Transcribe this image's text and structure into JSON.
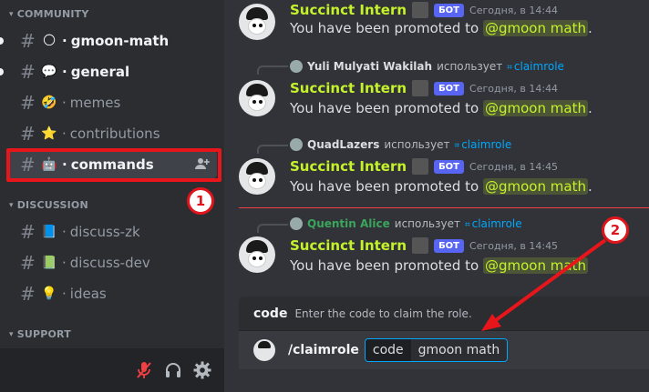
{
  "sidebar": {
    "categories": [
      {
        "label": "COMMUNITY"
      },
      {
        "label": "DISCUSSION"
      },
      {
        "label": "SUPPORT"
      }
    ],
    "channels": [
      {
        "name": "gmoon-math",
        "emoji": "🌕"
      },
      {
        "name": "general",
        "emoji": "💬"
      },
      {
        "name": "memes",
        "emoji": "🤣"
      },
      {
        "name": "contributions",
        "emoji": "⭐"
      },
      {
        "name": "commands",
        "emoji": "🤖"
      },
      {
        "name": "discuss-zk",
        "emoji": "📘"
      },
      {
        "name": "discuss-dev",
        "emoji": "📗"
      },
      {
        "name": "ideas",
        "emoji": "💡"
      }
    ],
    "hash": "#",
    "dot": "·",
    "chevron": "⌄"
  },
  "annotations": {
    "badge1": "1",
    "badge2": "2"
  },
  "messages": [
    {
      "author": "Succinct Intern",
      "bot_tag": "БОТ",
      "time": "Сегодня, в 14:44",
      "text_prefix": "You have been promoted to ",
      "mention": "@gmoon math",
      "text_suffix": "."
    },
    {
      "reply_user": "Yuli Mulyati Wakilah",
      "reply_uses": "использует",
      "reply_cmd": "claimrole",
      "author": "Succinct Intern",
      "bot_tag": "БОТ",
      "time": "Сегодня, в 14:44",
      "text_prefix": "You have been promoted to ",
      "mention": "@gmoon math",
      "text_suffix": "."
    },
    {
      "reply_user": "QuadLazers",
      "reply_uses": "использует",
      "reply_cmd": "claimrole",
      "author": "Succinct Intern",
      "bot_tag": "БОТ",
      "time": "Сегодня, в 14:45",
      "text_prefix": "You have been promoted to ",
      "mention": "@gmoon math",
      "text_suffix": "."
    },
    {
      "reply_user": "Quentin Alice",
      "reply_uses": "использует",
      "reply_cmd": "claimrole",
      "author": "Succinct Intern",
      "bot_tag": "БОТ",
      "time": "Сегодня, в 14:45",
      "text_prefix": "You have been promoted to ",
      "mention": "@gmoon math",
      "text_suffix": ""
    }
  ],
  "command_panel": {
    "option_name": "code",
    "option_desc": "Enter the code to claim the role.",
    "command": "/claimrole",
    "input_key": "code",
    "input_value": "gmoon math"
  },
  "colors": {
    "accent_red": "#e8151b",
    "username": "#c5f22a",
    "bot_tag": "#5865f2",
    "link_blue": "#00a8fc"
  },
  "icons": {
    "add_user": "person-add-icon",
    "mic_muted": "mic-muted-icon",
    "headphones": "headphones-icon",
    "settings": "gear-icon"
  }
}
